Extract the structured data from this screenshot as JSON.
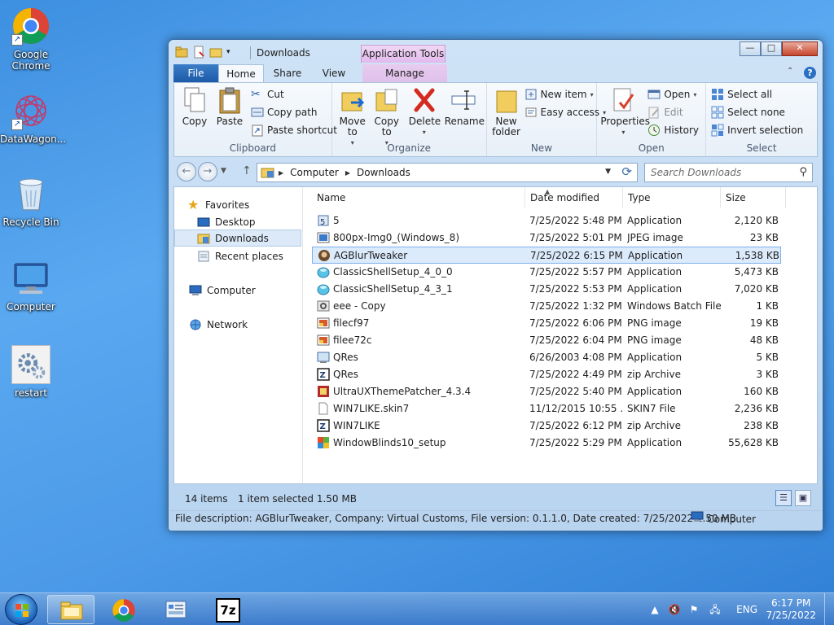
{
  "desktop": {
    "icons": [
      {
        "label": "Google Chrome"
      },
      {
        "label": "DataWagon..."
      },
      {
        "label": "Recycle Bin"
      },
      {
        "label": "Computer"
      },
      {
        "label": "restart"
      }
    ]
  },
  "window": {
    "title": "Downloads",
    "contextual_group": "Application Tools",
    "tabs": {
      "file": "File",
      "home": "Home",
      "share": "Share",
      "view": "View",
      "manage": "Manage"
    },
    "caption": {
      "minimize": "—",
      "maximize": "□",
      "close": "✕"
    }
  },
  "ribbon": {
    "clipboard": {
      "label": "Clipboard",
      "copy": "Copy",
      "paste": "Paste",
      "cut": "Cut",
      "copy_path": "Copy path",
      "paste_shortcut": "Paste shortcut"
    },
    "organize": {
      "label": "Organize",
      "move_to": "Move to",
      "copy_to": "Copy to",
      "delete": "Delete",
      "rename": "Rename"
    },
    "new": {
      "label": "New",
      "new_folder": "New folder",
      "new_item": "New item",
      "easy_access": "Easy access"
    },
    "open": {
      "label": "Open",
      "properties": "Properties",
      "open": "Open",
      "edit": "Edit",
      "history": "History"
    },
    "select": {
      "label": "Select",
      "select_all": "Select all",
      "select_none": "Select none",
      "invert_selection": "Invert selection"
    }
  },
  "address": {
    "crumbs": [
      "Computer",
      "Downloads"
    ],
    "search_placeholder": "Search Downloads"
  },
  "navpane": {
    "favorites": "Favorites",
    "desktop": "Desktop",
    "downloads": "Downloads",
    "recent": "Recent places",
    "computer": "Computer",
    "network": "Network"
  },
  "columns": {
    "name": "Name",
    "date": "Date modified",
    "type": "Type",
    "size": "Size"
  },
  "files": [
    {
      "name": "5",
      "date": "7/25/2022 5:48 PM",
      "type": "Application",
      "size": "2,120 KB",
      "icon": "app-icon"
    },
    {
      "name": "800px-Img0_(Windows_8)",
      "date": "7/25/2022 5:01 PM",
      "type": "JPEG image",
      "size": "23 KB",
      "icon": "jpeg-icon"
    },
    {
      "name": "AGBlurTweaker",
      "date": "7/25/2022 6:15 PM",
      "type": "Application",
      "size": "1,538 KB",
      "icon": "agblur-icon"
    },
    {
      "name": "ClassicShellSetup_4_0_0",
      "date": "7/25/2022 5:57 PM",
      "type": "Application",
      "size": "5,473 KB",
      "icon": "shell-icon"
    },
    {
      "name": "ClassicShellSetup_4_3_1",
      "date": "7/25/2022 5:53 PM",
      "type": "Application",
      "size": "7,020 KB",
      "icon": "shell-icon"
    },
    {
      "name": "eee - Copy",
      "date": "7/25/2022 1:32 PM",
      "type": "Windows Batch File",
      "size": "1 KB",
      "icon": "batch-icon"
    },
    {
      "name": "filecf97",
      "date": "7/25/2022 6:06 PM",
      "type": "PNG image",
      "size": "19 KB",
      "icon": "png-icon"
    },
    {
      "name": "filee72c",
      "date": "7/25/2022 6:04 PM",
      "type": "PNG image",
      "size": "48 KB",
      "icon": "png-icon"
    },
    {
      "name": "QRes",
      "date": "6/26/2003 4:08 PM",
      "type": "Application",
      "size": "5 KB",
      "icon": "qres-icon"
    },
    {
      "name": "QRes",
      "date": "7/25/2022 4:49 PM",
      "type": "zip Archive",
      "size": "3 KB",
      "icon": "zip-icon"
    },
    {
      "name": "UltraUXThemePatcher_4.3.4",
      "date": "7/25/2022 5:40 PM",
      "type": "Application",
      "size": "160 KB",
      "icon": "patcher-icon"
    },
    {
      "name": "WIN7LIKE.skin7",
      "date": "11/12/2015 10:55 ...",
      "type": "SKIN7 File",
      "size": "2,236 KB",
      "icon": "file-icon"
    },
    {
      "name": "WIN7LIKE",
      "date": "7/25/2022 6:12 PM",
      "type": "zip Archive",
      "size": "238 KB",
      "icon": "zip-icon"
    },
    {
      "name": "WindowBlinds10_setup",
      "date": "7/25/2022 5:29 PM",
      "type": "Application",
      "size": "55,628 KB",
      "icon": "windowblinds-icon"
    }
  ],
  "status": {
    "count": "14 items",
    "selected": "1 item selected  1.50 MB",
    "details": "File description: AGBlurTweaker, Company: Virtual Customs, File version: 0.1.1.0, Date created: 7/25/2022  1.50 MB",
    "computer": "Computer"
  },
  "taskbar": {
    "lang": "ENG",
    "time": "6:17 PM",
    "date": "7/25/2022",
    "sevenzip": "7z"
  }
}
